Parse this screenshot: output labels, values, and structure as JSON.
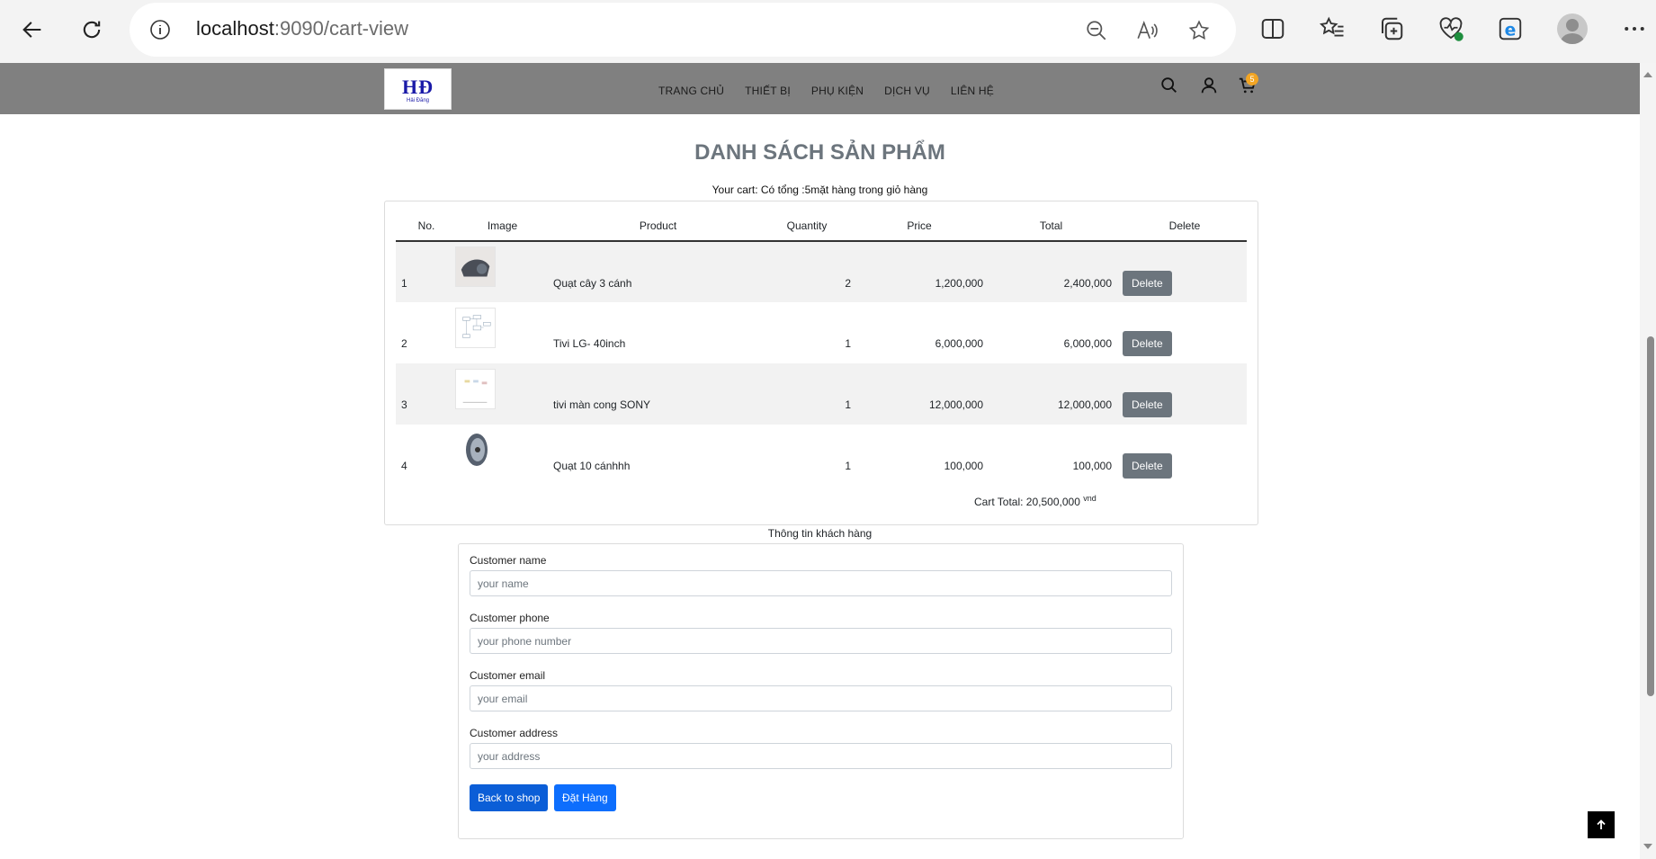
{
  "browser": {
    "url_host": "localhost",
    "url_path": ":9090/cart-view"
  },
  "site": {
    "logo_text": "HĐ",
    "logo_sub": "Hải Đăng",
    "nav": [
      "TRANG CHỦ",
      "THIẾT BỊ",
      "PHỤ KIỆN",
      "DỊCH VỤ",
      "LIÊN HỆ"
    ],
    "cart_count": "5"
  },
  "page": {
    "title": "DANH SÁCH SẢN PHẨM",
    "cart_info": "Your cart: Có tổng :5mặt hàng trong giỏ hàng"
  },
  "cart": {
    "headers": {
      "no": "No.",
      "image": "Image",
      "product": "Product",
      "quantity": "Quantity",
      "price": "Price",
      "total": "Total",
      "delete": "Delete"
    },
    "rows": [
      {
        "no": "1",
        "product": "Quạt cây 3 cánh",
        "quantity": "2",
        "price": "1,200,000",
        "total": "2,400,000",
        "delete": "Delete"
      },
      {
        "no": "2",
        "product": "Tivi LG- 40inch",
        "quantity": "1",
        "price": "6,000,000",
        "total": "6,000,000",
        "delete": "Delete"
      },
      {
        "no": "3",
        "product": "tivi màn cong SONY",
        "quantity": "1",
        "price": "12,000,000",
        "total": "12,000,000",
        "delete": "Delete"
      },
      {
        "no": "4",
        "product": "Quạt 10 cánhhh",
        "quantity": "1",
        "price": "100,000",
        "total": "100,000",
        "delete": "Delete"
      }
    ],
    "total_label": "Cart Total: 20,500,000",
    "currency": "vnd"
  },
  "customer": {
    "heading": "Thông tin khách hàng",
    "name_label": "Customer name",
    "name_placeholder": "your name",
    "phone_label": "Customer phone",
    "phone_placeholder": "your phone number",
    "email_label": "Customer email",
    "email_placeholder": "your email",
    "address_label": "Customer address",
    "address_placeholder": "your address",
    "back_button": "Back to shop",
    "order_button": "Đặt Hàng"
  },
  "colors": {
    "header_bg": "#808080",
    "delete_btn": "#6c757d",
    "primary": "#0d6efd",
    "badge": "#f2a524"
  }
}
